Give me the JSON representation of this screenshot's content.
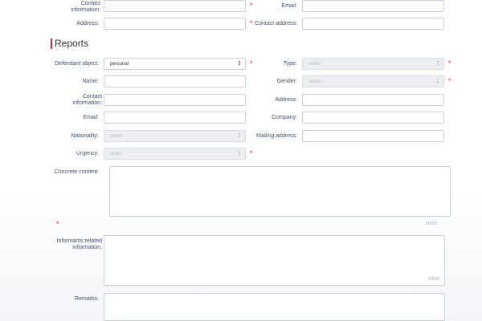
{
  "top": {
    "contact_label": "Contact\ninformation:",
    "email_label": "Email:",
    "address_label": "Address:",
    "contact_address_label": "Contact address:",
    "contact_value": "",
    "email_value": "",
    "address_value": "",
    "contact_address_value": ""
  },
  "reports": {
    "title": "Reports",
    "defendant_object_label": "Defendant object:",
    "defendant_object_value": "personal",
    "type_label": "Type:",
    "type_placeholder": "select",
    "name_label": "Name:",
    "gender_label": "Gender:",
    "gender_placeholder": "select",
    "contact_label": "Contact\ninformation:",
    "address_label": "Address:",
    "email_label": "Email:",
    "company_label": "Company:",
    "nationality_label": "Nationality:",
    "nationality_placeholder": "select",
    "mailing_address_label": "Mailing address:",
    "urgency_label": "Urgency:",
    "urgency_placeholder": "select",
    "concrete_content_label": "Concrete content:",
    "concrete_content_counter": "0/500",
    "informants_label": "Informants related\ninformation:",
    "informants_counter": "0/500",
    "remarks_label": "Remarks:"
  },
  "required_mark": "*",
  "colors": {
    "accent": "#d81e28",
    "required": "#e0262d",
    "label": "#3f4f73",
    "border": "#c9ced8",
    "disabled_bg": "#eceef1"
  }
}
